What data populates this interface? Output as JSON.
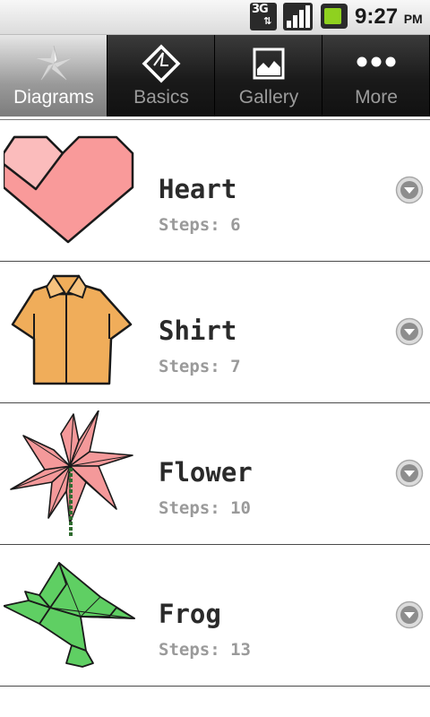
{
  "status_bar": {
    "network": "3G",
    "time": "9:27",
    "ampm": "PM",
    "battery_color": "#8fd11f"
  },
  "tabs": [
    {
      "label": "Diagrams",
      "icon": "origami-star-icon",
      "selected": true
    },
    {
      "label": "Basics",
      "icon": "fold-diamond-icon",
      "selected": false
    },
    {
      "label": "Gallery",
      "icon": "picture-icon",
      "selected": false
    },
    {
      "label": "More",
      "icon": "more-dots-icon",
      "selected": false
    }
  ],
  "items": [
    {
      "title": "Heart",
      "steps": "Steps: 6",
      "icon": "origami-heart-icon"
    },
    {
      "title": "Shirt",
      "steps": "Steps: 7",
      "icon": "origami-shirt-icon"
    },
    {
      "title": "Flower",
      "steps": "Steps: 10",
      "icon": "origami-flower-icon"
    },
    {
      "title": "Frog",
      "steps": "Steps: 13",
      "icon": "origami-frog-icon"
    }
  ],
  "colors": {
    "heart": "#f99a9a",
    "shirt": "#f0ad5a",
    "flower": "#f4999a",
    "frog": "#5fcf63"
  }
}
